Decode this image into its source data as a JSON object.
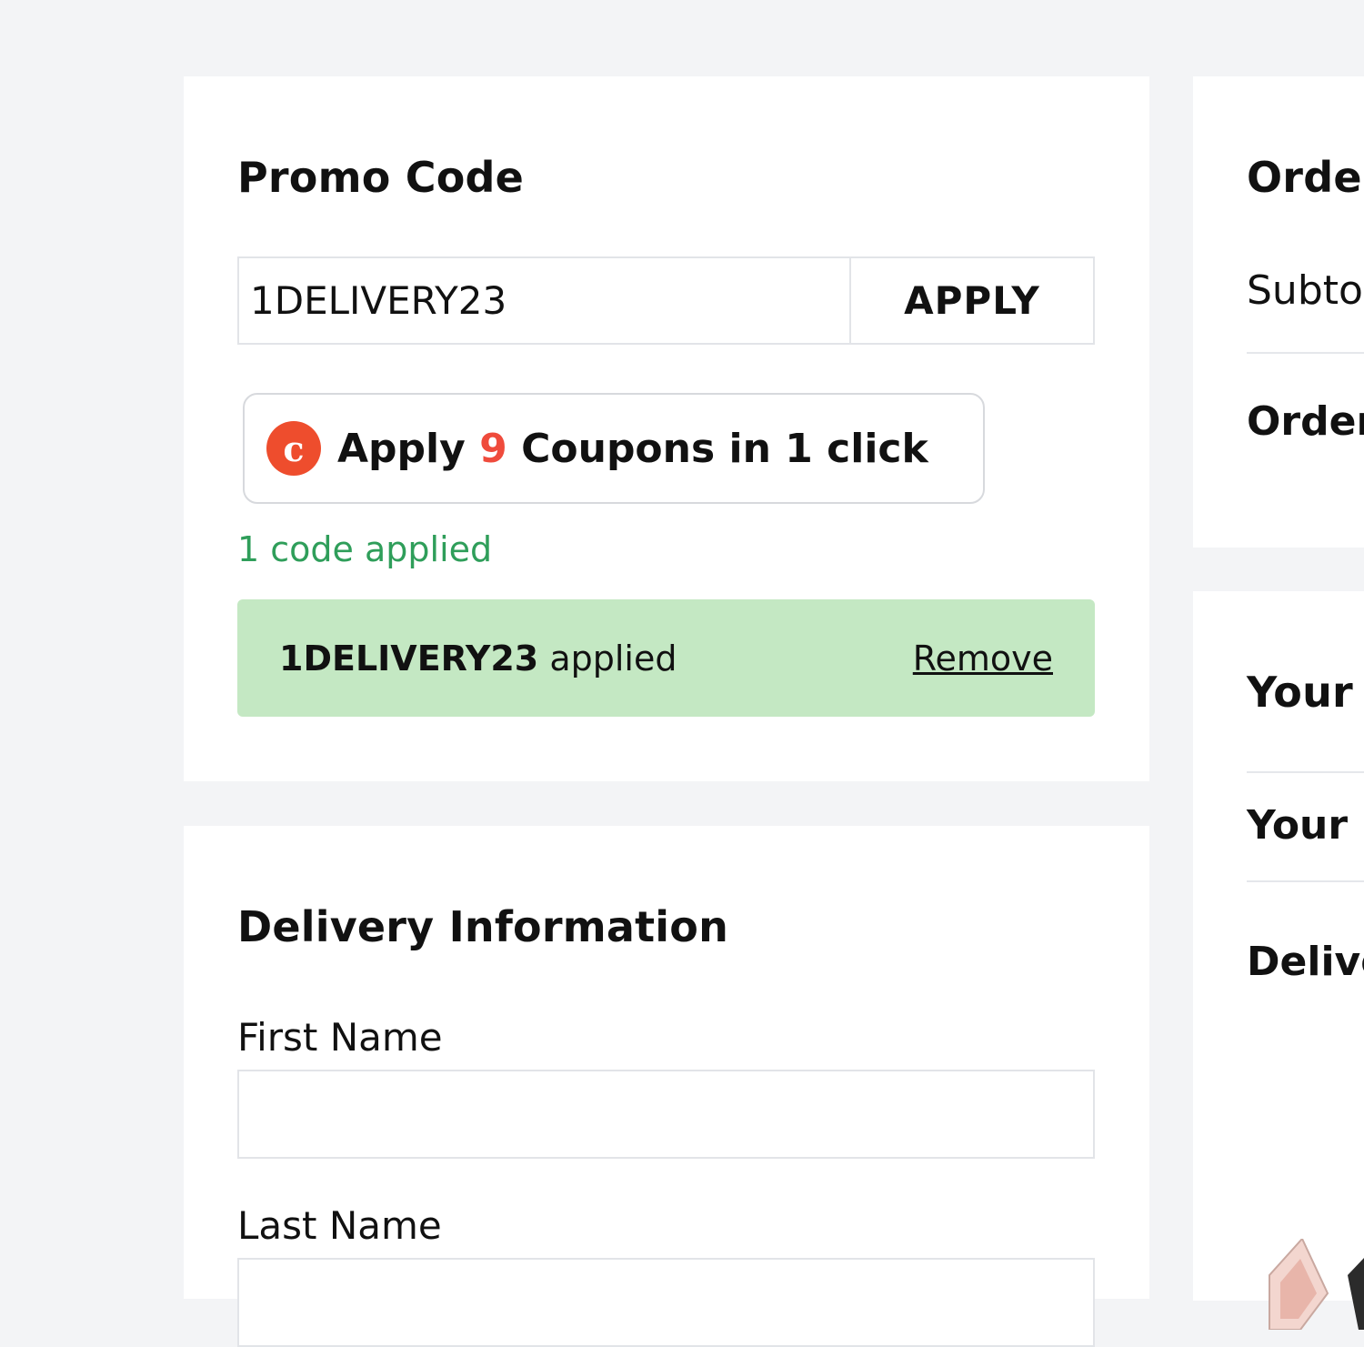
{
  "promo": {
    "title": "Promo Code",
    "input_value": "1DELIVERY23",
    "apply_label": "APPLY",
    "coupon_button": {
      "prefix": "Apply",
      "count": "9",
      "suffix": "Coupons in 1 click",
      "logo_glyph": "c"
    },
    "applied_count_text": "1 code applied",
    "applied": {
      "code": "1DELIVERY23",
      "suffix": "applied",
      "remove_label": "Remove"
    }
  },
  "delivery": {
    "title": "Delivery Information",
    "first_name_label": "First Name",
    "last_name_label": "Last Name"
  },
  "summary": {
    "title": "Orde",
    "subtotal_label": "Subto",
    "order_label": "Order"
  },
  "cart": {
    "title": "Your",
    "subtitle": "Your I",
    "delivery_label": "Delive"
  },
  "colors": {
    "page_bg": "#f3f4f6",
    "applied_bg": "#c4e8c3",
    "applied_count_green": "#2f9e5a",
    "coupon_accent": "#ef4b3c"
  }
}
